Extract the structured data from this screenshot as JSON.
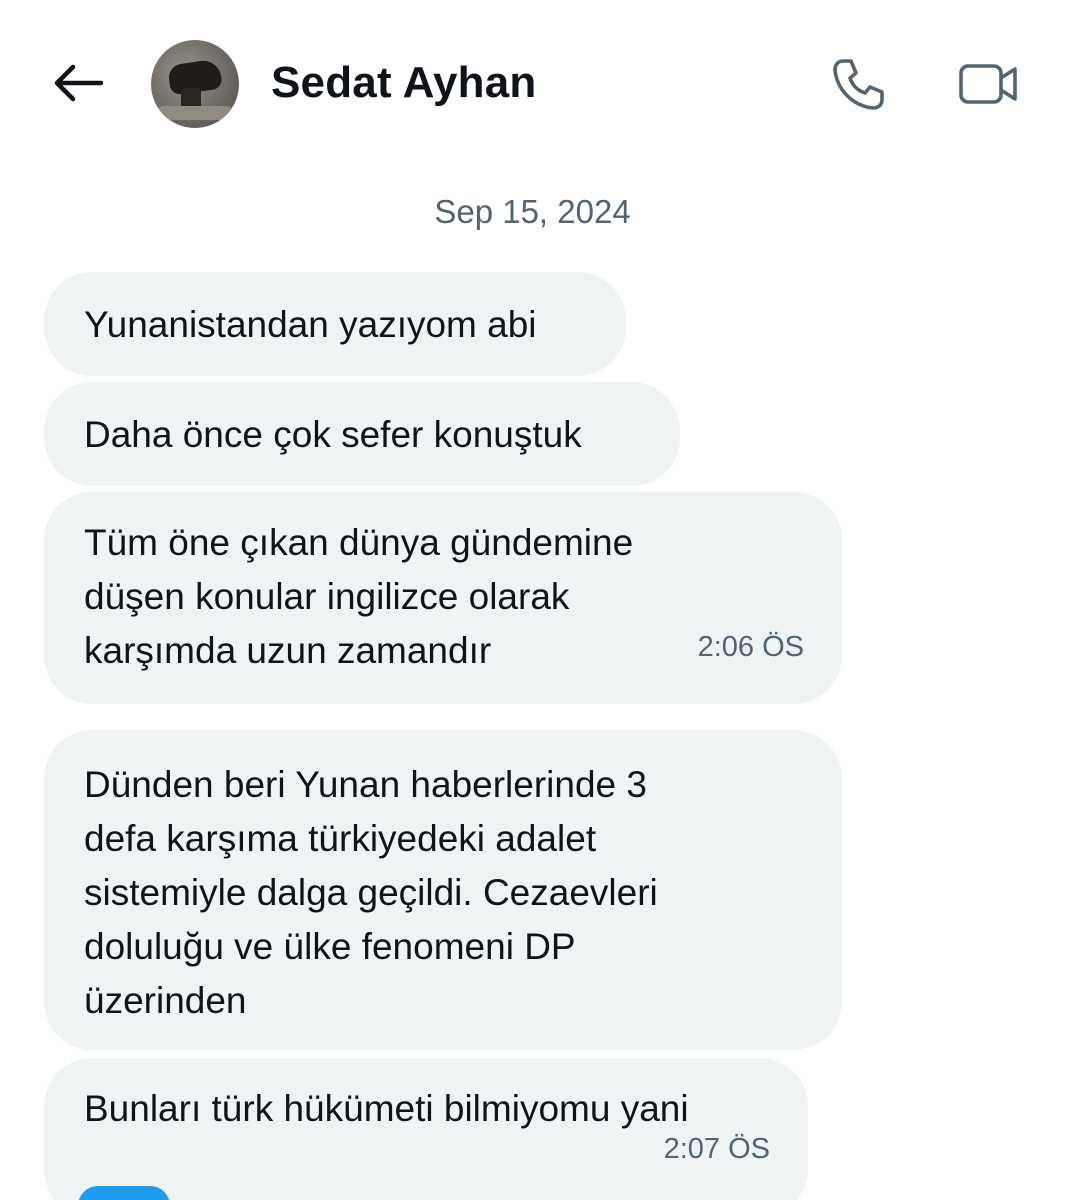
{
  "header": {
    "contact_name": "Sedat Ayhan",
    "back_icon": "arrow-left-icon",
    "call_icon": "phone-icon",
    "video_icon": "video-camera-icon"
  },
  "conversation": {
    "date": "Sep 15, 2024",
    "messages": [
      {
        "text": "Yunanistandan yazıyom abi",
        "time": ""
      },
      {
        "text": "Daha önce çok sefer konuştuk",
        "time": ""
      },
      {
        "text": "Tüm öne çıkan dünya gündemine\ndüşen konular ingilizce olarak\nkarşımda uzun zamandır",
        "time": "2:06 ÖS"
      },
      {
        "text": "Dünden beri Yunan haberlerinde 3\ndefa karşıma türkiyedeki adalet\nsistemiyle dalga geçildi. Cezaevleri\ndoluluğu ve ülke fenomeni DP\nüzerinden",
        "time": ""
      },
      {
        "text": "Bunları türk hükümeti bilmiyomu yani",
        "time": "2:07 ÖS"
      }
    ]
  },
  "colors": {
    "bubble_bg": "#eff3f4",
    "text_primary": "#0f1419",
    "text_secondary": "#536471",
    "accent": "#1d9bf0"
  }
}
